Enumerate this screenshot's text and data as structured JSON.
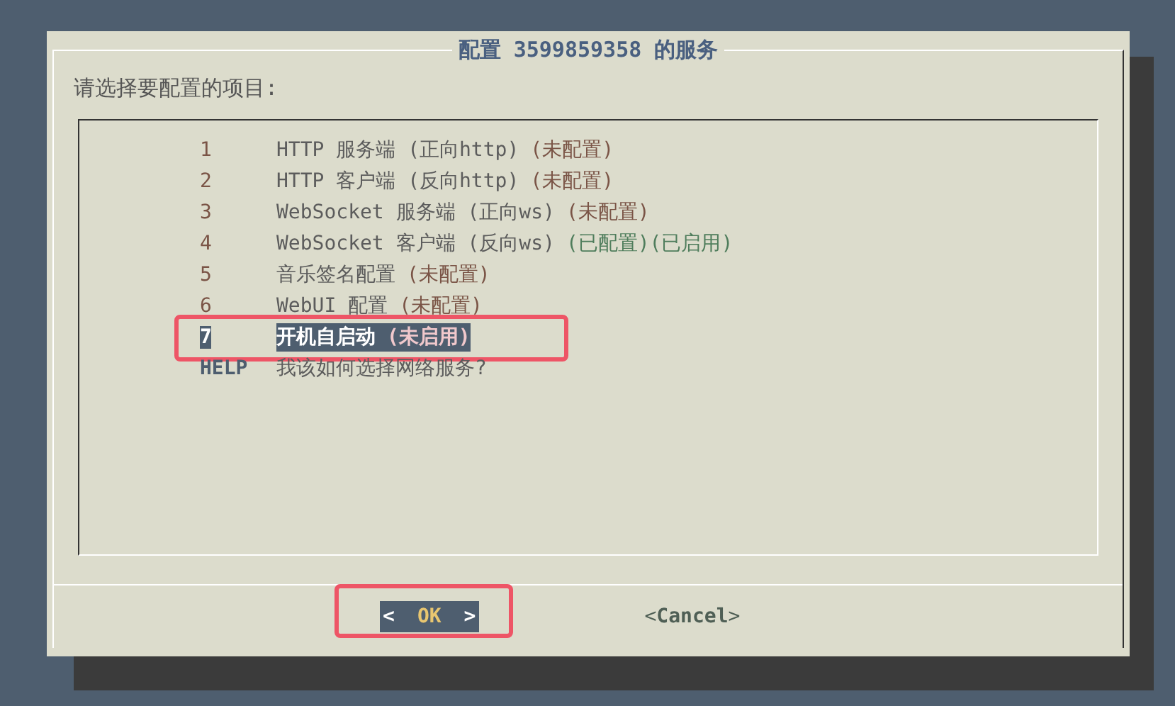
{
  "dialog": {
    "title": "配置 3599859358 的服务",
    "prompt": "请选择要配置的项目:"
  },
  "items": [
    {
      "tag": "1",
      "label": "HTTP 服务端 (正向http)",
      "statuses": [
        {
          "text": "(未配置)",
          "kind": "pending"
        }
      ],
      "selected": false,
      "annotated": false
    },
    {
      "tag": "2",
      "label": "HTTP 客户端 (反向http)",
      "statuses": [
        {
          "text": "(未配置)",
          "kind": "pending"
        }
      ],
      "selected": false,
      "annotated": false
    },
    {
      "tag": "3",
      "label": "WebSocket 服务端 (正向ws)",
      "statuses": [
        {
          "text": "(未配置)",
          "kind": "pending"
        }
      ],
      "selected": false,
      "annotated": false
    },
    {
      "tag": "4",
      "label": "WebSocket 客户端 (反向ws)",
      "statuses": [
        {
          "text": "(已配置)",
          "kind": "done"
        },
        {
          "text": "(已启用)",
          "kind": "done"
        }
      ],
      "selected": false,
      "annotated": false
    },
    {
      "tag": "5",
      "label": "音乐签名配置",
      "statuses": [
        {
          "text": "(未配置)",
          "kind": "pending"
        }
      ],
      "selected": false,
      "annotated": false
    },
    {
      "tag": "6",
      "label": "WebUI 配置",
      "statuses": [
        {
          "text": "(未配置)",
          "kind": "pending"
        }
      ],
      "selected": false,
      "annotated": false
    },
    {
      "tag": "7",
      "label": "开机自启动",
      "statuses": [
        {
          "text": "(未启用)",
          "kind": "pending"
        }
      ],
      "selected": true,
      "annotated": true
    },
    {
      "tag": "HELP",
      "label": "我该如何选择网络服务?",
      "selected": false,
      "annotated": false
    }
  ],
  "buttons": [
    {
      "left": "<",
      "label": "OK",
      "right": ">",
      "selected": true,
      "annotated": true
    },
    {
      "left": "<",
      "label": "Cancel",
      "right": ">",
      "selected": false,
      "annotated": false
    }
  ]
}
